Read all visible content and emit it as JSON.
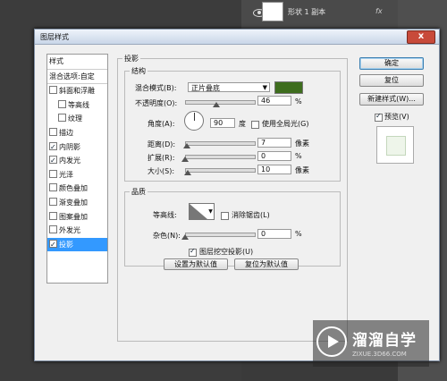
{
  "layer_panel": {
    "layer_name": "形状 1 副本",
    "fx_label": "fx"
  },
  "dialog": {
    "title": "图层样式",
    "close_label": "x",
    "styles_list": [
      {
        "label": "样式",
        "checkbox": false,
        "checked": false,
        "header": true,
        "selected": false
      },
      {
        "label": "混合选项:自定",
        "checkbox": false,
        "checked": false,
        "header": true,
        "selected": false
      },
      {
        "label": "斜面和浮雕",
        "checkbox": true,
        "checked": false,
        "indent": false,
        "selected": false
      },
      {
        "label": "等高线",
        "checkbox": true,
        "checked": false,
        "indent": true,
        "selected": false
      },
      {
        "label": "纹理",
        "checkbox": true,
        "checked": false,
        "indent": true,
        "selected": false
      },
      {
        "label": "描边",
        "checkbox": true,
        "checked": false,
        "indent": false,
        "selected": false
      },
      {
        "label": "内阴影",
        "checkbox": true,
        "checked": true,
        "indent": false,
        "selected": false
      },
      {
        "label": "内发光",
        "checkbox": true,
        "checked": true,
        "indent": false,
        "selected": false
      },
      {
        "label": "光泽",
        "checkbox": true,
        "checked": false,
        "indent": false,
        "selected": false
      },
      {
        "label": "颜色叠加",
        "checkbox": true,
        "checked": false,
        "indent": false,
        "selected": false
      },
      {
        "label": "渐变叠加",
        "checkbox": true,
        "checked": false,
        "indent": false,
        "selected": false
      },
      {
        "label": "图案叠加",
        "checkbox": true,
        "checked": false,
        "indent": false,
        "selected": false
      },
      {
        "label": "外发光",
        "checkbox": true,
        "checked": false,
        "indent": false,
        "selected": false
      },
      {
        "label": "投影",
        "checkbox": true,
        "checked": true,
        "indent": false,
        "selected": true
      }
    ],
    "section_title": "投影",
    "structure": {
      "title": "结构",
      "blend_mode_label": "混合模式(B):",
      "blend_mode_value": "正片叠底",
      "shadow_color": "#3e6d1e",
      "opacity_label": "不透明度(O):",
      "opacity_value": "46",
      "opacity_fraction": 0.46,
      "angle_label": "角度(A):",
      "angle_value": "90",
      "angle_unit": "度",
      "global_light_label": "使用全局光(G)",
      "global_light_checked": false,
      "distance_label": "距离(D):",
      "distance_value": "7",
      "distance_unit": "像素",
      "distance_fraction": 0.03,
      "spread_label": "扩展(R):",
      "spread_value": "0",
      "spread_fraction": 0,
      "size_label": "大小(S):",
      "size_value": "10",
      "size_unit": "像素",
      "size_fraction": 0.04,
      "percent_unit": "%"
    },
    "quality": {
      "title": "品质",
      "contour_label": "等高线:",
      "antialias_label": "消除锯齿(L)",
      "antialias_checked": false,
      "noise_label": "杂色(N):",
      "noise_value": "0",
      "noise_fraction": 0,
      "percent_unit": "%"
    },
    "knockout_label": "图层挖空投影(U)",
    "knockout_checked": true,
    "set_default_label": "设置为默认值",
    "reset_default_label": "复位为默认值",
    "ok_label": "确定",
    "reset_label": "复位",
    "new_style_label": "新建样式(W)...",
    "preview_label": "预览(V)",
    "preview_checked": true
  },
  "watermark": {
    "brand": "溜溜自学",
    "url": "ZIXUE.3D66.COM"
  }
}
